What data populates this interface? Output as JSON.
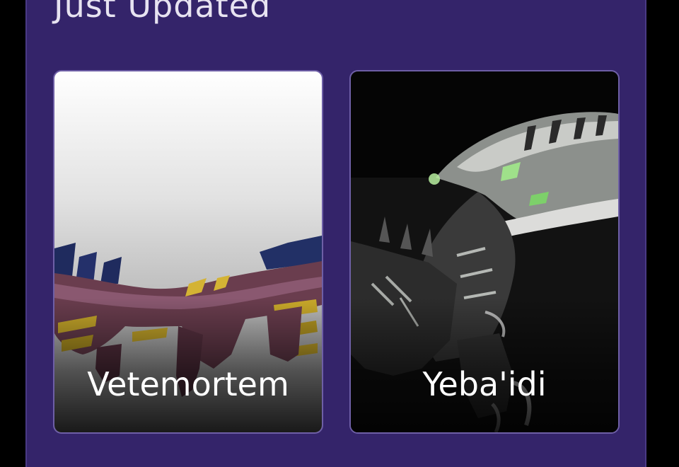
{
  "section": {
    "title": "Just Updated"
  },
  "cards": [
    {
      "name": "Vetemortem",
      "image": "creature-artwork-vetemortem"
    },
    {
      "name": "Yeba'idi",
      "image": "creature-artwork-yebaidi"
    }
  ],
  "colors": {
    "page_background": "#000000",
    "panel_background": "#34246a",
    "card_border": "#6e5fa6",
    "title_text": "#e7e3f1",
    "card_text": "#ffffff"
  }
}
